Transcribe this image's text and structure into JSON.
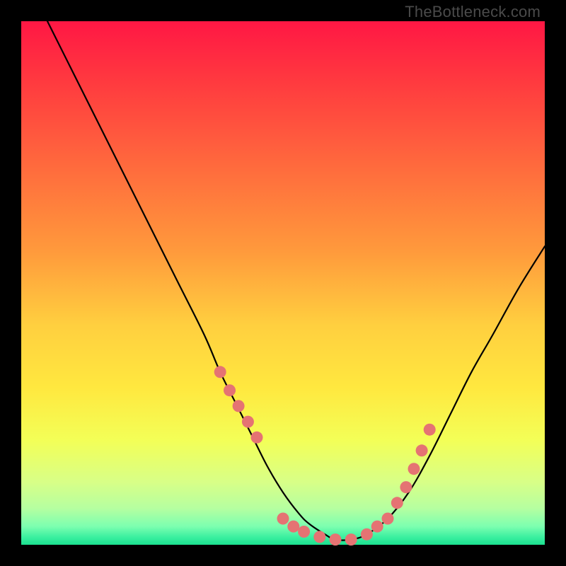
{
  "watermark": "TheBottleneck.com",
  "colors": {
    "frame": "#000000",
    "curve": "#000000",
    "dots": "#e57373",
    "gradient_stops": [
      {
        "offset": 0.0,
        "color": "#ff1744"
      },
      {
        "offset": 0.12,
        "color": "#ff3b3f"
      },
      {
        "offset": 0.28,
        "color": "#ff6b3d"
      },
      {
        "offset": 0.44,
        "color": "#ff9a3c"
      },
      {
        "offset": 0.58,
        "color": "#ffcf3f"
      },
      {
        "offset": 0.7,
        "color": "#ffe83f"
      },
      {
        "offset": 0.8,
        "color": "#f3ff57"
      },
      {
        "offset": 0.88,
        "color": "#d8ff87"
      },
      {
        "offset": 0.93,
        "color": "#b6ffa0"
      },
      {
        "offset": 0.965,
        "color": "#7cffb0"
      },
      {
        "offset": 0.985,
        "color": "#3cf0a0"
      },
      {
        "offset": 1.0,
        "color": "#1be090"
      }
    ]
  },
  "chart_data": {
    "type": "line",
    "title": "",
    "xlabel": "",
    "ylabel": "",
    "xlim": [
      0,
      100
    ],
    "ylim": [
      0,
      100
    ],
    "grid": false,
    "legend": false,
    "series": [
      {
        "name": "bottleneck-curve",
        "x": [
          5,
          10,
          15,
          20,
          25,
          30,
          35,
          38,
          41,
          44,
          47,
          50,
          53,
          55,
          58,
          60,
          63,
          66,
          70,
          74,
          78,
          82,
          86,
          90,
          95,
          100
        ],
        "values": [
          100,
          90,
          80,
          70,
          60,
          50,
          40,
          33,
          27,
          21,
          15,
          10,
          6,
          4,
          2,
          1,
          1,
          2,
          5,
          10,
          17,
          25,
          33,
          40,
          49,
          57
        ]
      }
    ],
    "highlight_points": {
      "name": "bottleneck-band-dots",
      "x": [
        38.0,
        39.8,
        41.5,
        43.3,
        45.0,
        50.0,
        52.0,
        54.0,
        57.0,
        60.0,
        63.0,
        66.0,
        68.0,
        70.0,
        71.8,
        73.5,
        75.0,
        76.5,
        78.0
      ],
      "values": [
        33.0,
        29.5,
        26.5,
        23.5,
        20.5,
        5.0,
        3.5,
        2.5,
        1.5,
        1.0,
        1.0,
        2.0,
        3.5,
        5.0,
        8.0,
        11.0,
        14.5,
        18.0,
        22.0
      ]
    }
  }
}
